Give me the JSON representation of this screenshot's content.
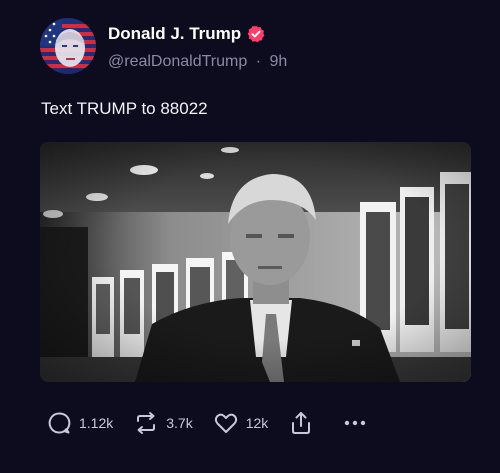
{
  "author": {
    "name": "Donald J. Trump",
    "handle": "@realDonaldTrump",
    "separator": "·",
    "time": "9h"
  },
  "post": {
    "text": "Text TRUMP to 88022"
  },
  "actions": {
    "replies": "1.12k",
    "reposts": "3.7k",
    "likes": "12k"
  },
  "colors": {
    "background": "#0d0b1e",
    "verified_badge": "#ff3d6a",
    "muted_text": "#8b8aa3",
    "icon": "#c9c8d8"
  },
  "icons": {
    "verified": "verified-badge-icon",
    "reply": "reply-bubble-icon",
    "repost": "repost-arrows-icon",
    "like": "heart-icon",
    "share": "share-upload-icon",
    "more": "more-dots-icon"
  }
}
